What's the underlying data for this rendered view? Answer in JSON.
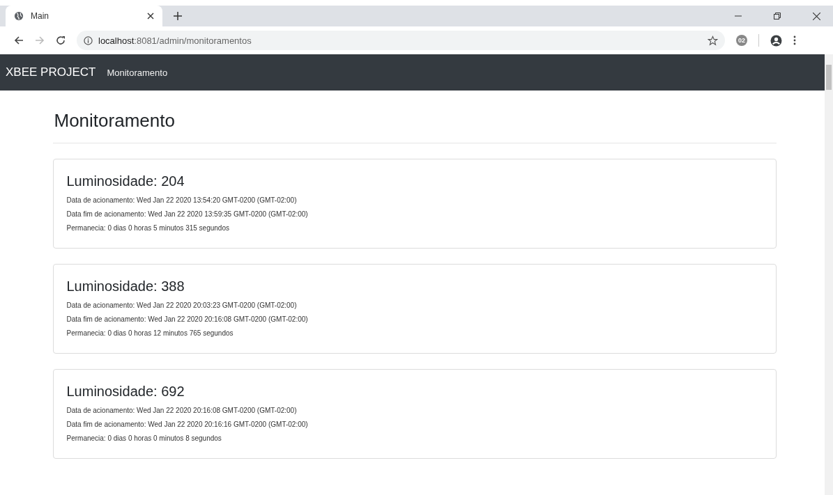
{
  "browser": {
    "tab_title": "Main",
    "url_host": "localhost",
    "url_path": ":8081/admin/monitoramentos",
    "extension_badge": "02"
  },
  "navbar": {
    "brand": "XBEE PROJECT",
    "links": [
      "Monitoramento"
    ]
  },
  "page": {
    "title": "Monitoramento"
  },
  "cards": [
    {
      "title": "Luminosidade: 204",
      "lines": [
        "Data de acionamento: Wed Jan 22 2020 13:54:20 GMT-0200 (GMT-02:00)",
        "Data fim de acionamento: Wed Jan 22 2020 13:59:35 GMT-0200 (GMT-02:00)",
        "Permanecia: 0 dias 0 horas 5 minutos 315 segundos"
      ]
    },
    {
      "title": "Luminosidade: 388",
      "lines": [
        "Data de acionamento: Wed Jan 22 2020 20:03:23 GMT-0200 (GMT-02:00)",
        "Data fim de acionamento: Wed Jan 22 2020 20:16:08 GMT-0200 (GMT-02:00)",
        "Permanecia: 0 dias 0 horas 12 minutos 765 segundos"
      ]
    },
    {
      "title": "Luminosidade: 692",
      "lines": [
        "Data de acionamento: Wed Jan 22 2020 20:16:08 GMT-0200 (GMT-02:00)",
        "Data fim de acionamento: Wed Jan 22 2020 20:16:16 GMT-0200 (GMT-02:00)",
        "Permanecia: 0 dias 0 horas 0 minutos 8 segundos"
      ]
    }
  ]
}
